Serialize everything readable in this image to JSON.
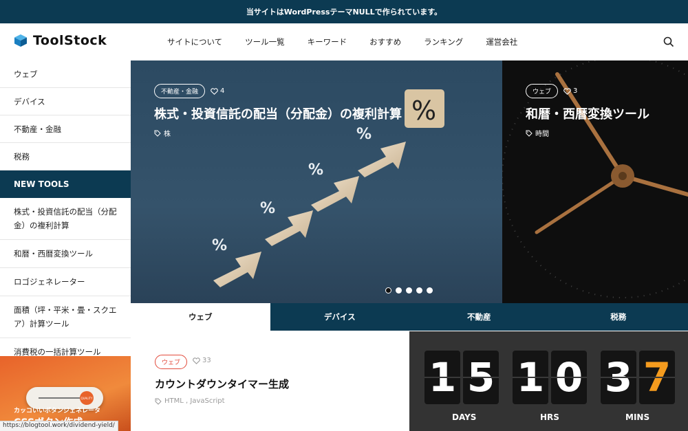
{
  "topbar": {
    "text": "当サイトはWordPressテーマNULLで作られています。"
  },
  "header": {
    "logo_text": "ToolStock",
    "nav": [
      "サイトについて",
      "ツール一覧",
      "キーワード",
      "おすすめ",
      "ランキング",
      "運営会社"
    ],
    "search_icon": "search-icon"
  },
  "sidebar": {
    "categories": [
      "ウェブ",
      "デバイス",
      "不動産・金融",
      "税務"
    ],
    "new_tools_heading": "NEW TOOLS",
    "new_tools": [
      "株式・投資信託の配当（分配金）の複利計算",
      "和暦・西暦変換ツール",
      "ロゴジェネレーター",
      "面積（坪・平米・畳・スクエア）計算ツール",
      "消費税の一括計算ツール"
    ],
    "promo": {
      "line1": "カッコいいボタンジェネレータ",
      "line2": "CSSボタン作成",
      "knob_text": "QUALITY"
    }
  },
  "hero": {
    "main": {
      "category": "不動産・金融",
      "likes": "4",
      "title": "株式・投資信託の配当（分配金）の複利計算",
      "tag": "株"
    },
    "side": {
      "category": "ウェブ",
      "likes": "3",
      "title": "和暦・西暦変換ツール",
      "tag": "時間"
    },
    "slide_count": 5,
    "active_slide": 1
  },
  "tabs": [
    "ウェブ",
    "デバイス",
    "不動産",
    "税務"
  ],
  "active_tab": 0,
  "card": {
    "category": "ウェブ",
    "likes": "33",
    "title": "カウントダウンタイマー生成",
    "tags": "HTML , JavaScript",
    "timer": {
      "digits": [
        "1",
        "5",
        "1",
        "0",
        "3",
        "7"
      ],
      "labels": [
        "DAYS",
        "HRS",
        "MINS"
      ]
    }
  },
  "status_url": "https://blogtool.work/dividend-yield/",
  "colors": {
    "navy": "#0c3a52",
    "accent_red": "#e24a3b",
    "orange": "#f49b1e"
  }
}
